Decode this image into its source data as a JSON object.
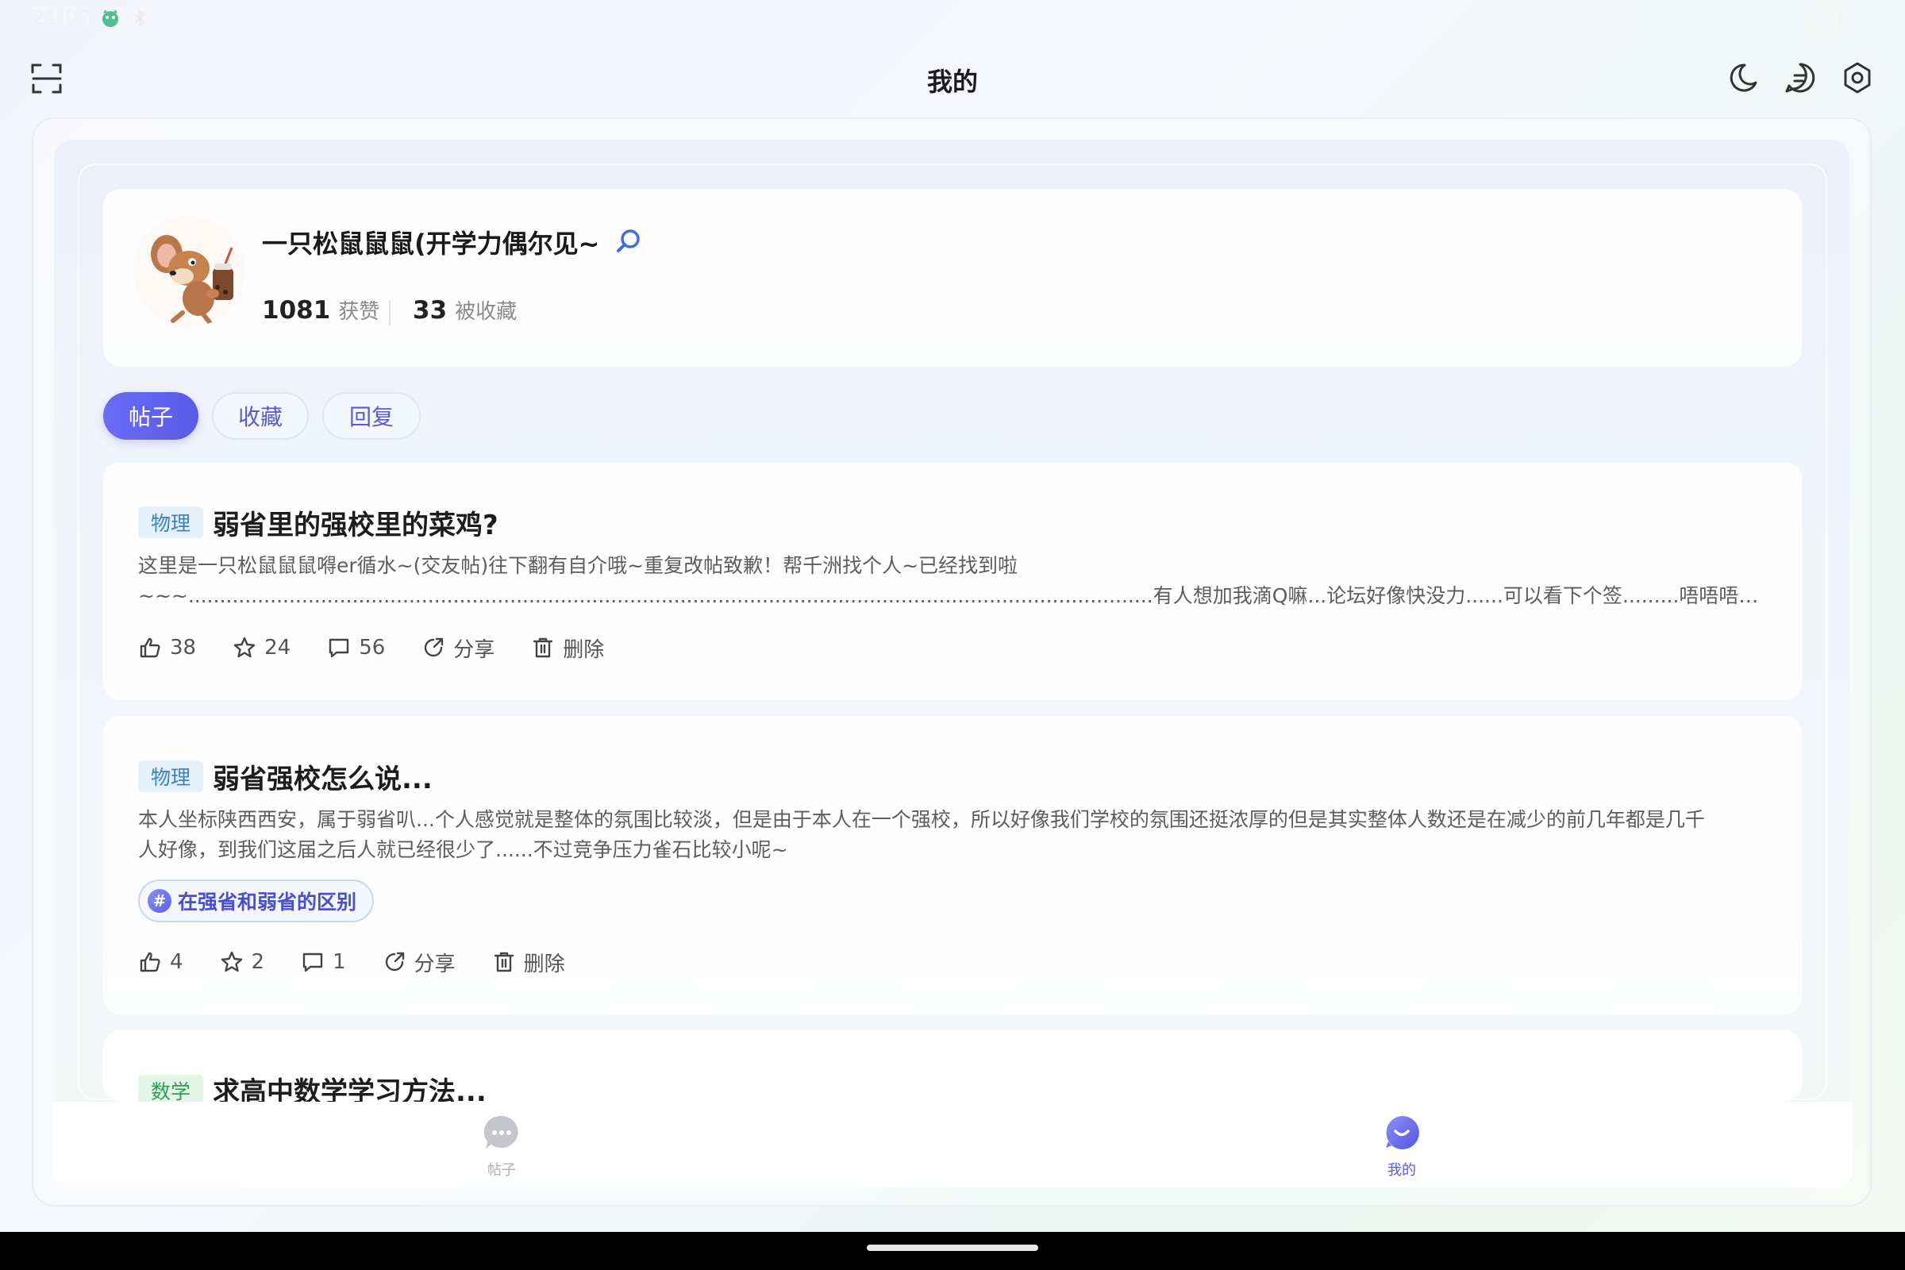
{
  "status_bar": {
    "time": "21:07"
  },
  "header": {
    "title": "我的"
  },
  "profile": {
    "username": "一只松鼠鼠鼠(开学力偶尔见~",
    "likes_count": "1081",
    "likes_label": "获赞",
    "favorites_count": "33",
    "favorites_label": "被收藏"
  },
  "tabs": [
    {
      "label": "帖子",
      "active": true
    },
    {
      "label": "收藏",
      "active": false
    },
    {
      "label": "回复",
      "active": false
    }
  ],
  "posts": [
    {
      "tag": "物理",
      "title": "弱省里的强校里的菜鸡?",
      "body_lines": [
        "这里是一只松鼠鼠鼠嘚er循水~(交友帖)往下翻有自介哦~重复改帖致歉！帮千洲找个人~已经找到啦",
        "~~~.........................................................................................................................................................有人想加我滴Q嘛...论坛好像快没力......可以看下个签.........唔唔唔，下面这是最近在用的一…"
      ],
      "likes": "38",
      "stars": "24",
      "comments": "56",
      "share_label": "分享",
      "delete_label": "删除"
    },
    {
      "tag": "物理",
      "title": "弱省强校怎么说...",
      "body_lines": [
        "本人坐标陕西西安，属于弱省叭...个人感觉就是整体的氛围比较淡，但是由于本人在一个强校，所以好像我们学校的氛围还挺浓厚的但是其实整体人数还是在减少的前几年都是几千",
        "人好像，到我们这届之后人就已经很少了......不过竞争压力雀石比较小呢~"
      ],
      "topic": "在强省和弱省的区别",
      "likes": "4",
      "stars": "2",
      "comments": "1",
      "share_label": "分享",
      "delete_label": "删除"
    },
    {
      "tag": "数学",
      "title": "求高中数学学习方法..."
    }
  ],
  "bottom_nav": {
    "posts_label": "帖子",
    "mine_label": "我的",
    "active_color": "#5a5be6",
    "inactive_color": "#b5b5b5"
  },
  "colors": {
    "accent": "#5a5be6",
    "physics_tag_bg": "#e5f1fb",
    "math_tag_bg": "#e3f6e8"
  }
}
